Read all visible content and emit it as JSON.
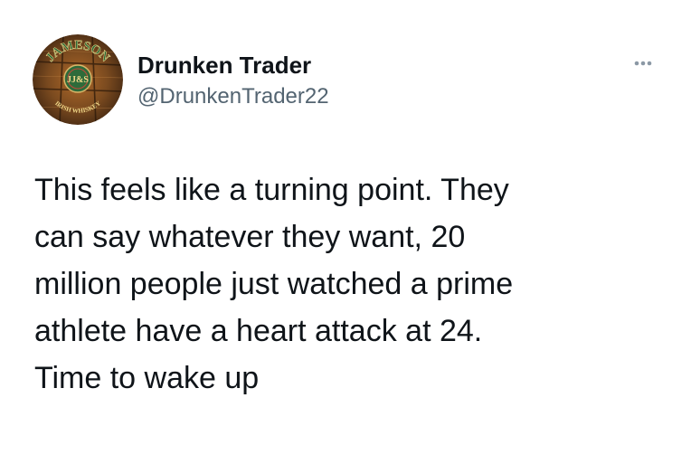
{
  "tweet": {
    "author": {
      "display_name": "Drunken Trader",
      "handle": "@DrunkenTrader22",
      "avatar": {
        "icon": "jameson-barrel-avatar-icon",
        "logo_text_top": "JAMESON",
        "logo_text_center": "JJ&S",
        "logo_text_bottom": "IRISH WHISKEY"
      }
    },
    "more_icon": "more-options-icon",
    "text_lines": [
      "This feels like a turning point. They",
      "can say whatever they want, 20",
      "million people just watched a prime",
      "athlete have a heart attack at 24.",
      "Time to wake up"
    ],
    "colors": {
      "text": "#0f1419",
      "secondary_text": "#536471",
      "more_icon": "#8b98a5",
      "avatar_wood": "#7a4a1f",
      "avatar_logo_green": "#2e6b3a",
      "background": "#ffffff"
    }
  }
}
